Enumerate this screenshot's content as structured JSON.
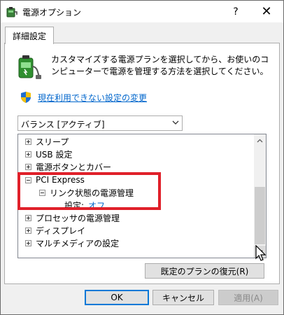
{
  "window": {
    "title": "電源オプション",
    "help_label": "?",
    "close_label": "✕"
  },
  "tab": {
    "label": "詳細設定"
  },
  "description": "カスタマイズする電源プランを選択してから、お使いのコンピューターで電源を管理する方法を選択してください。",
  "change_link": "現在利用できない設定の変更",
  "plan_select": {
    "value": "バランス [アクティブ]"
  },
  "tree": {
    "items": [
      {
        "label": "スリープ",
        "expander": "plus"
      },
      {
        "label": "USB 設定",
        "expander": "plus"
      },
      {
        "label": "電源ボタンとカバー",
        "expander": "plus"
      },
      {
        "label": "PCI Express",
        "expander": "minus"
      },
      {
        "label": "リンク状態の電源管理",
        "expander": "minus"
      },
      {
        "label": "設定:",
        "value": "オフ"
      },
      {
        "label": "プロセッサの電源管理",
        "expander": "plus"
      },
      {
        "label": "ディスプレイ",
        "expander": "plus"
      },
      {
        "label": "マルチメディアの設定",
        "expander": "plus"
      }
    ]
  },
  "buttons": {
    "restore": "既定のプランの復元(R)",
    "ok": "OK",
    "cancel": "キャンセル",
    "apply": "適用(A)"
  },
  "colors": {
    "link": "#0066cc",
    "highlight": "#e0202a",
    "focus_border": "#0078d7"
  },
  "icons": [
    "power-options-icon",
    "battery-plug-icon",
    "uac-shield-icon",
    "chevron-down-icon",
    "scroll-up-icon",
    "scroll-down-icon",
    "mouse-cursor-icon"
  ]
}
